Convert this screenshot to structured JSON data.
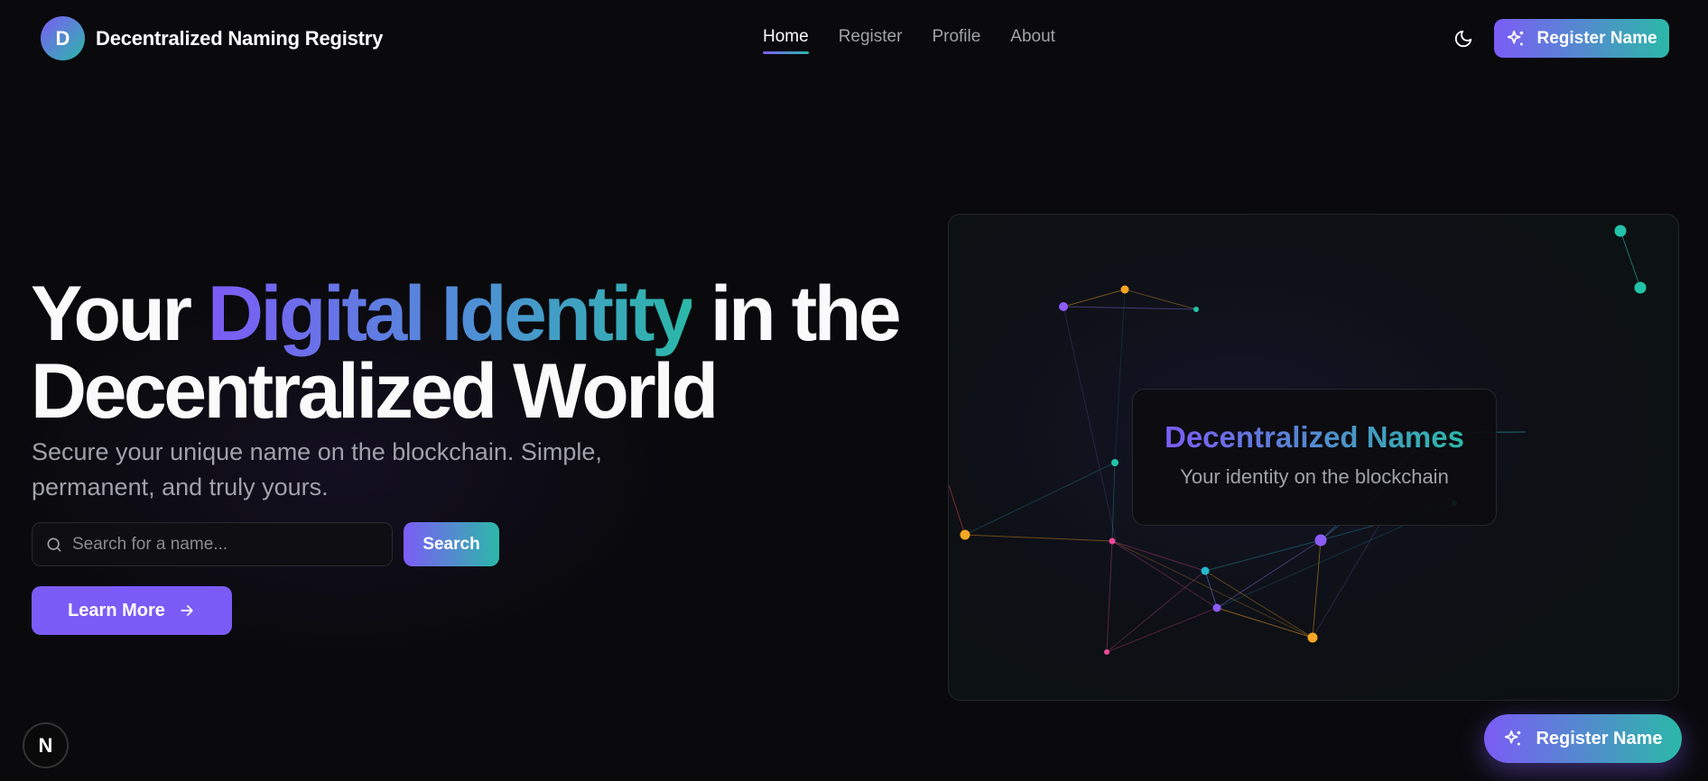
{
  "brand": {
    "logo_letter": "D",
    "name": "Decentralized Naming Registry"
  },
  "nav": {
    "links": [
      {
        "label": "Home",
        "active": true
      },
      {
        "label": "Register",
        "active": false
      },
      {
        "label": "Profile",
        "active": false
      },
      {
        "label": "About",
        "active": false
      }
    ],
    "theme_icon": "moon-icon",
    "register_button": "Register Name"
  },
  "hero": {
    "title_part1": "Your ",
    "title_highlight": "Digital Identity",
    "title_part2": " in the Decentralized World",
    "subtitle": "Secure your unique name on the blockchain. Simple, permanent, and truly yours.",
    "search": {
      "placeholder": "Search for a name...",
      "value": "",
      "button": "Search"
    },
    "learn_more": "Learn More"
  },
  "panel": {
    "card_title": "Decentralized Names",
    "card_subtitle": "Your identity on the blockchain"
  },
  "floating": {
    "register_button": "Register Name",
    "badge_letter": "N"
  },
  "colors": {
    "accent_purple": "#7c5cf6",
    "accent_teal": "#2bb8a8",
    "background": "#0a0a0d",
    "node_orange": "#f5a623",
    "node_pink": "#ec4899",
    "node_cyan": "#22b8cf"
  }
}
